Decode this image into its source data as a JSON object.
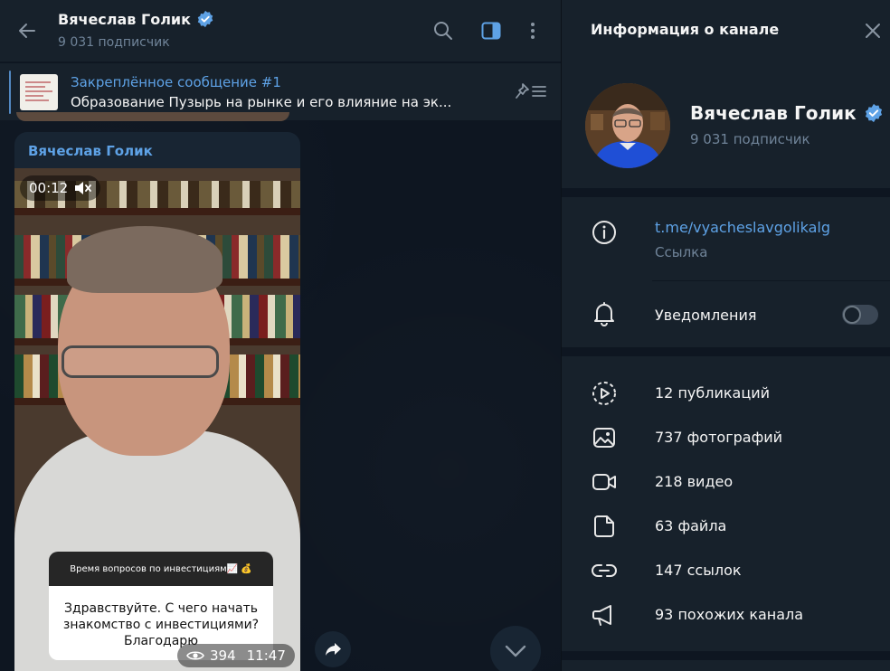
{
  "chat": {
    "title": "Вячеслав Голик",
    "subtitle": "9 031 подписчик",
    "pinned": {
      "label": "Закреплённое сообщение #1",
      "text": "Образование  Пузырь на рынке и его влияние на эк..."
    },
    "message": {
      "author": "Вячеслав Голик",
      "video_duration": "00:12",
      "story_header": "Время вопросов по инвестициям📈 💰",
      "story_question": "Здравствуйте. С чего начать знакомство с инвестициями? Благодарю",
      "views": "394",
      "time": "11:47"
    }
  },
  "info": {
    "title": "Информация о канале",
    "name": "Вячеслав Голик",
    "subscribers": "9 031 подписчик",
    "link": "t.me/vyacheslavgolikalg",
    "link_caption": "Ссылка",
    "notifications_label": "Уведомления",
    "notifications_on": false,
    "media": [
      {
        "icon": "story-icon",
        "label": "12 публикаций"
      },
      {
        "icon": "photo-icon",
        "label": "737 фотографий"
      },
      {
        "icon": "video-icon",
        "label": "218 видео"
      },
      {
        "icon": "file-icon",
        "label": "63 файла"
      },
      {
        "icon": "link-icon",
        "label": "147 ссылок"
      },
      {
        "icon": "megaphone-icon",
        "label": "93 похожих канала"
      }
    ]
  },
  "colors": {
    "accent": "#5ea2e6",
    "panel": "#17212b",
    "background": "#0e1621",
    "muted": "#708499",
    "verified": "#5ea2e6"
  }
}
